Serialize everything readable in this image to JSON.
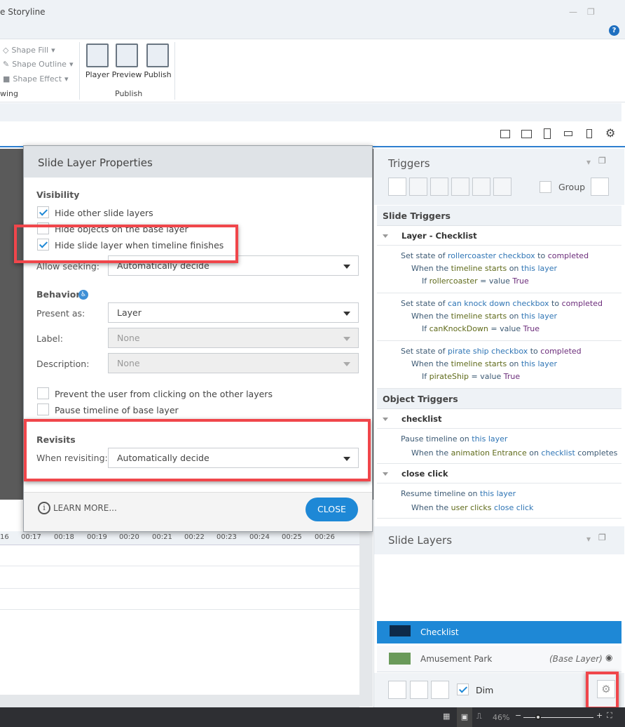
{
  "window": {
    "title": "e Storyline"
  },
  "ribbon": {
    "drawing": {
      "items": [
        "Shape Fill",
        "Shape Outline",
        "Shape Effect"
      ],
      "group_label": "wing"
    },
    "publish": {
      "buttons": [
        "Player",
        "Preview",
        "Publish"
      ],
      "group_label": "Publish"
    }
  },
  "timeline": {
    "ticks": [
      "16",
      "00:17",
      "00:18",
      "00:19",
      "00:20",
      "00:21",
      "00:22",
      "00:23",
      "00:24",
      "00:25",
      "00:26"
    ]
  },
  "dialog": {
    "title": "Slide Layer Properties",
    "visibility": {
      "heading": "Visibility",
      "options": [
        {
          "label": "Hide other slide layers",
          "checked": true
        },
        {
          "label": "Hide objects on the base layer",
          "checked": false
        },
        {
          "label": "Hide slide layer when timeline finishes",
          "checked": true
        }
      ],
      "allow_seeking_label": "Allow seeking:",
      "allow_seeking_value": "Automatically decide"
    },
    "behavior": {
      "heading": "Behavior",
      "present_as_label": "Present as:",
      "present_as_value": "Layer",
      "label_label": "Label:",
      "label_value": "None",
      "description_label": "Description:",
      "description_value": "None",
      "options": [
        {
          "label": "Prevent the user from clicking on the other layers",
          "checked": false
        },
        {
          "label": "Pause timeline of base layer",
          "checked": false
        }
      ]
    },
    "revisits": {
      "heading": "Revisits",
      "when_label": "When revisiting:",
      "when_value": "Automatically decide"
    },
    "learn_more": "LEARN MORE...",
    "close": "CLOSE"
  },
  "triggers": {
    "title": "Triggers",
    "group_label": "Group",
    "group_checked": false,
    "slide_triggers_heading": "Slide Triggers",
    "slide_group": "Layer - Checklist",
    "slide_items": [
      [
        [
          [
            "Set state of ",
            "n"
          ],
          [
            "rollercoaster checkbox",
            "o"
          ],
          [
            " to ",
            "n"
          ],
          [
            "completed",
            "v"
          ]
        ],
        [
          [
            "When the ",
            "n"
          ],
          [
            "timeline starts",
            "e"
          ],
          [
            " on ",
            "n"
          ],
          [
            "this layer",
            "o"
          ]
        ],
        [
          [
            "If ",
            "n"
          ],
          [
            "rollercoaster",
            "e"
          ],
          [
            " = value ",
            "n"
          ],
          [
            "True",
            "v"
          ]
        ]
      ],
      [
        [
          [
            "Set state of ",
            "n"
          ],
          [
            "can knock down checkbox",
            "o"
          ],
          [
            " to ",
            "n"
          ],
          [
            "completed",
            "v"
          ]
        ],
        [
          [
            "When the ",
            "n"
          ],
          [
            "timeline starts",
            "e"
          ],
          [
            " on ",
            "n"
          ],
          [
            "this layer",
            "o"
          ]
        ],
        [
          [
            "If ",
            "n"
          ],
          [
            "canKnockDown",
            "e"
          ],
          [
            " = value ",
            "n"
          ],
          [
            "True",
            "v"
          ]
        ]
      ],
      [
        [
          [
            "Set state of ",
            "n"
          ],
          [
            "pirate ship checkbox",
            "o"
          ],
          [
            " to ",
            "n"
          ],
          [
            "completed",
            "v"
          ]
        ],
        [
          [
            "When the ",
            "n"
          ],
          [
            "timeline starts",
            "e"
          ],
          [
            " on ",
            "n"
          ],
          [
            "this layer",
            "o"
          ]
        ],
        [
          [
            "If ",
            "n"
          ],
          [
            "pirateShip",
            "e"
          ],
          [
            " = value ",
            "n"
          ],
          [
            "True",
            "v"
          ]
        ]
      ]
    ],
    "object_triggers_heading": "Object Triggers",
    "object_groups": [
      {
        "name": "checklist",
        "lines": [
          [
            [
              "Pause timeline on ",
              "n"
            ],
            [
              "this layer",
              "o"
            ]
          ],
          [
            [
              "When the ",
              "n"
            ],
            [
              "animation Entrance",
              "e"
            ],
            [
              " on ",
              "n"
            ],
            [
              "checklist",
              "o"
            ],
            [
              " completes",
              "n"
            ]
          ]
        ]
      },
      {
        "name": "close click",
        "lines": [
          [
            [
              "Resume timeline on ",
              "n"
            ],
            [
              "this layer",
              "o"
            ]
          ],
          [
            [
              "When the ",
              "n"
            ],
            [
              "user clicks",
              "e"
            ],
            [
              " ",
              "n"
            ],
            [
              "close click",
              "o"
            ]
          ]
        ]
      }
    ]
  },
  "slide_layers": {
    "title": "Slide Layers",
    "layers": [
      {
        "name": "Checklist",
        "selected": true
      },
      {
        "name": "Amusement Park",
        "tag": "(Base Layer)"
      }
    ],
    "dim_label": "Dim",
    "dim_checked": true
  },
  "status": {
    "zoom": "46%"
  },
  "colors": {
    "accent": "#1e88d6",
    "highlight": "#f0464b"
  }
}
